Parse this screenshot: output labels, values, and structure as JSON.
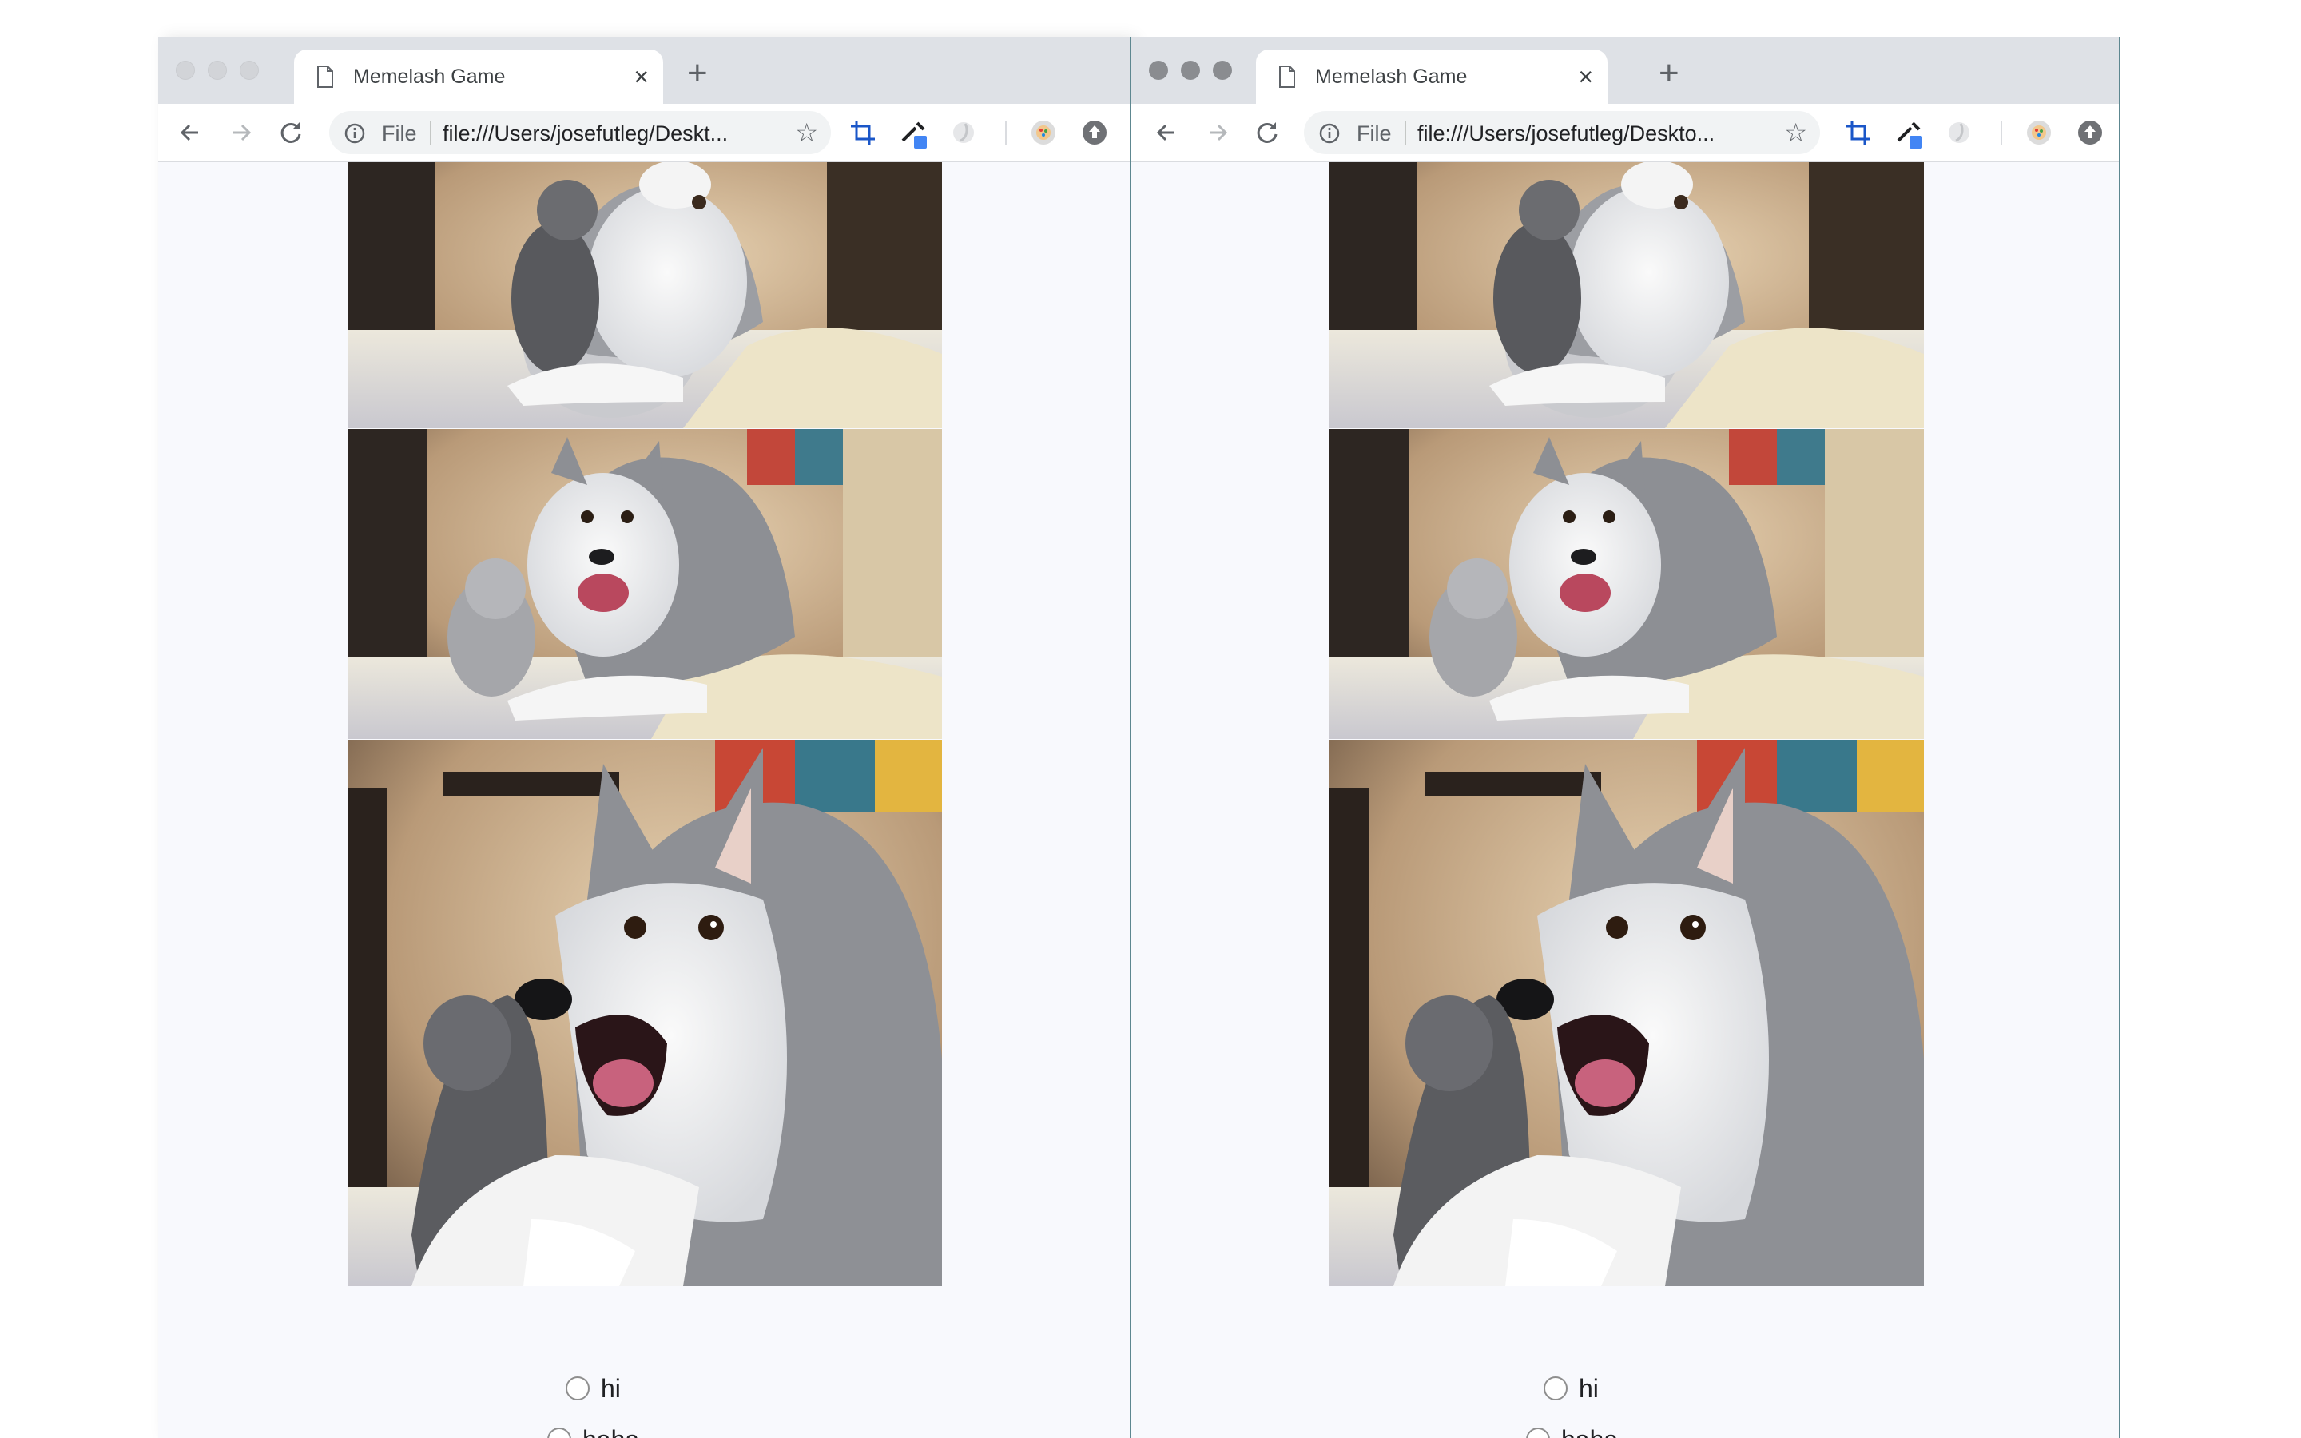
{
  "windows": [
    {
      "tab_title": "Memelash Game",
      "address": {
        "scheme_label": "File",
        "url": "file:///Users/josefutleg/Deskt..."
      },
      "meme_panels": [
        "dog-photo-panel-1",
        "dog-photo-panel-2",
        "dog-photo-panel-3"
      ],
      "choices": [
        {
          "label": "hi"
        },
        {
          "label": "haha"
        }
      ]
    },
    {
      "tab_title": "Memelash Game",
      "address": {
        "scheme_label": "File",
        "url": "file:///Users/josefutleg/Deskto..."
      },
      "meme_panels": [
        "dog-photo-panel-1",
        "dog-photo-panel-2",
        "dog-photo-panel-3"
      ],
      "choices": [
        {
          "label": "hi"
        },
        {
          "label": "haha"
        }
      ]
    }
  ],
  "colors": {
    "accent_blue": "#4285f4",
    "page_bg": "#f8f9fd",
    "chrome_bg": "#dee1e6"
  }
}
